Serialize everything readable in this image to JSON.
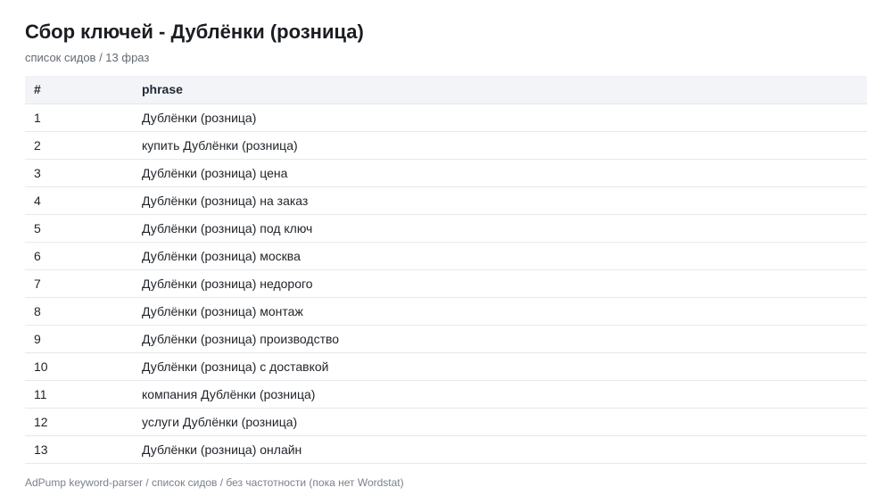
{
  "header": {
    "title": "Сбор ключей - Дублёнки (розница)",
    "subtitle": "список сидов / 13 фраз"
  },
  "table": {
    "columns": [
      "#",
      "phrase"
    ],
    "rows": [
      {
        "num": "1",
        "phrase": "Дублёнки (розница)"
      },
      {
        "num": "2",
        "phrase": "купить Дублёнки (розница)"
      },
      {
        "num": "3",
        "phrase": "Дублёнки (розница) цена"
      },
      {
        "num": "4",
        "phrase": "Дублёнки (розница) на заказ"
      },
      {
        "num": "5",
        "phrase": "Дублёнки (розница) под ключ"
      },
      {
        "num": "6",
        "phrase": "Дублёнки (розница) москва"
      },
      {
        "num": "7",
        "phrase": "Дублёнки (розница) недорого"
      },
      {
        "num": "8",
        "phrase": "Дублёнки (розница) монтаж"
      },
      {
        "num": "9",
        "phrase": "Дублёнки (розница) производство"
      },
      {
        "num": "10",
        "phrase": "Дублёнки (розница) с доставкой"
      },
      {
        "num": "11",
        "phrase": "компания Дублёнки (розница)"
      },
      {
        "num": "12",
        "phrase": "услуги Дублёнки (розница)"
      },
      {
        "num": "13",
        "phrase": "Дублёнки (розница) онлайн"
      }
    ]
  },
  "footer": {
    "text": "AdPump keyword-parser / список сидов / без частотности (пока нет Wordstat)"
  }
}
